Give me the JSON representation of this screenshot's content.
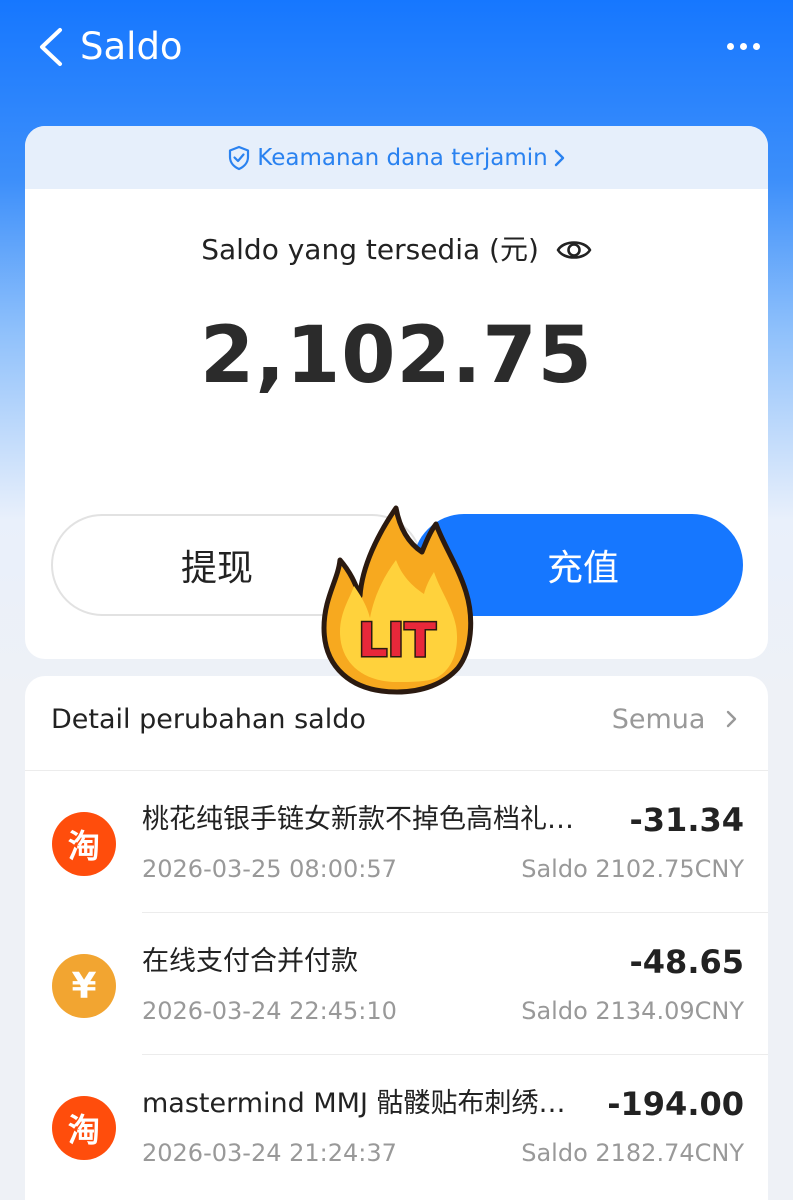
{
  "header": {
    "title": "Saldo"
  },
  "safety_banner": {
    "text": "Keamanan dana terjamin"
  },
  "balance": {
    "label": "Saldo yang tersedia (元)",
    "amount": "2,102.75"
  },
  "actions": {
    "withdraw": "提现",
    "topup": "充值"
  },
  "sticker": {
    "text": "LIT"
  },
  "details": {
    "title": "Detail perubahan saldo",
    "all_label": "Semua",
    "transactions": [
      {
        "icon": "taobao-icon",
        "icon_glyph": "淘",
        "name": "桃花纯银手链女新款不掉色高档礼物送女友闺蜜",
        "amount": "-31.34",
        "date": "2026-03-25 08:00:57",
        "balance": "Saldo 2102.75CNY"
      },
      {
        "icon": "yuan-icon",
        "icon_glyph": "¥",
        "name": "在线支付合并付款",
        "amount": "-48.65",
        "date": "2026-03-24 22:45:10",
        "balance": "Saldo 2134.09CNY"
      },
      {
        "icon": "taobao-icon",
        "icon_glyph": "淘",
        "name": "mastermind MMJ 骷髅贴布刺绣卫衣男",
        "amount": "-194.00",
        "date": "2026-03-24 21:24:37",
        "balance": "Saldo 2182.74CNY"
      }
    ]
  },
  "colors": {
    "primary": "#1677ff",
    "taobao": "#ff4d0c",
    "yuan": "#f2a531",
    "muted": "#999999"
  }
}
